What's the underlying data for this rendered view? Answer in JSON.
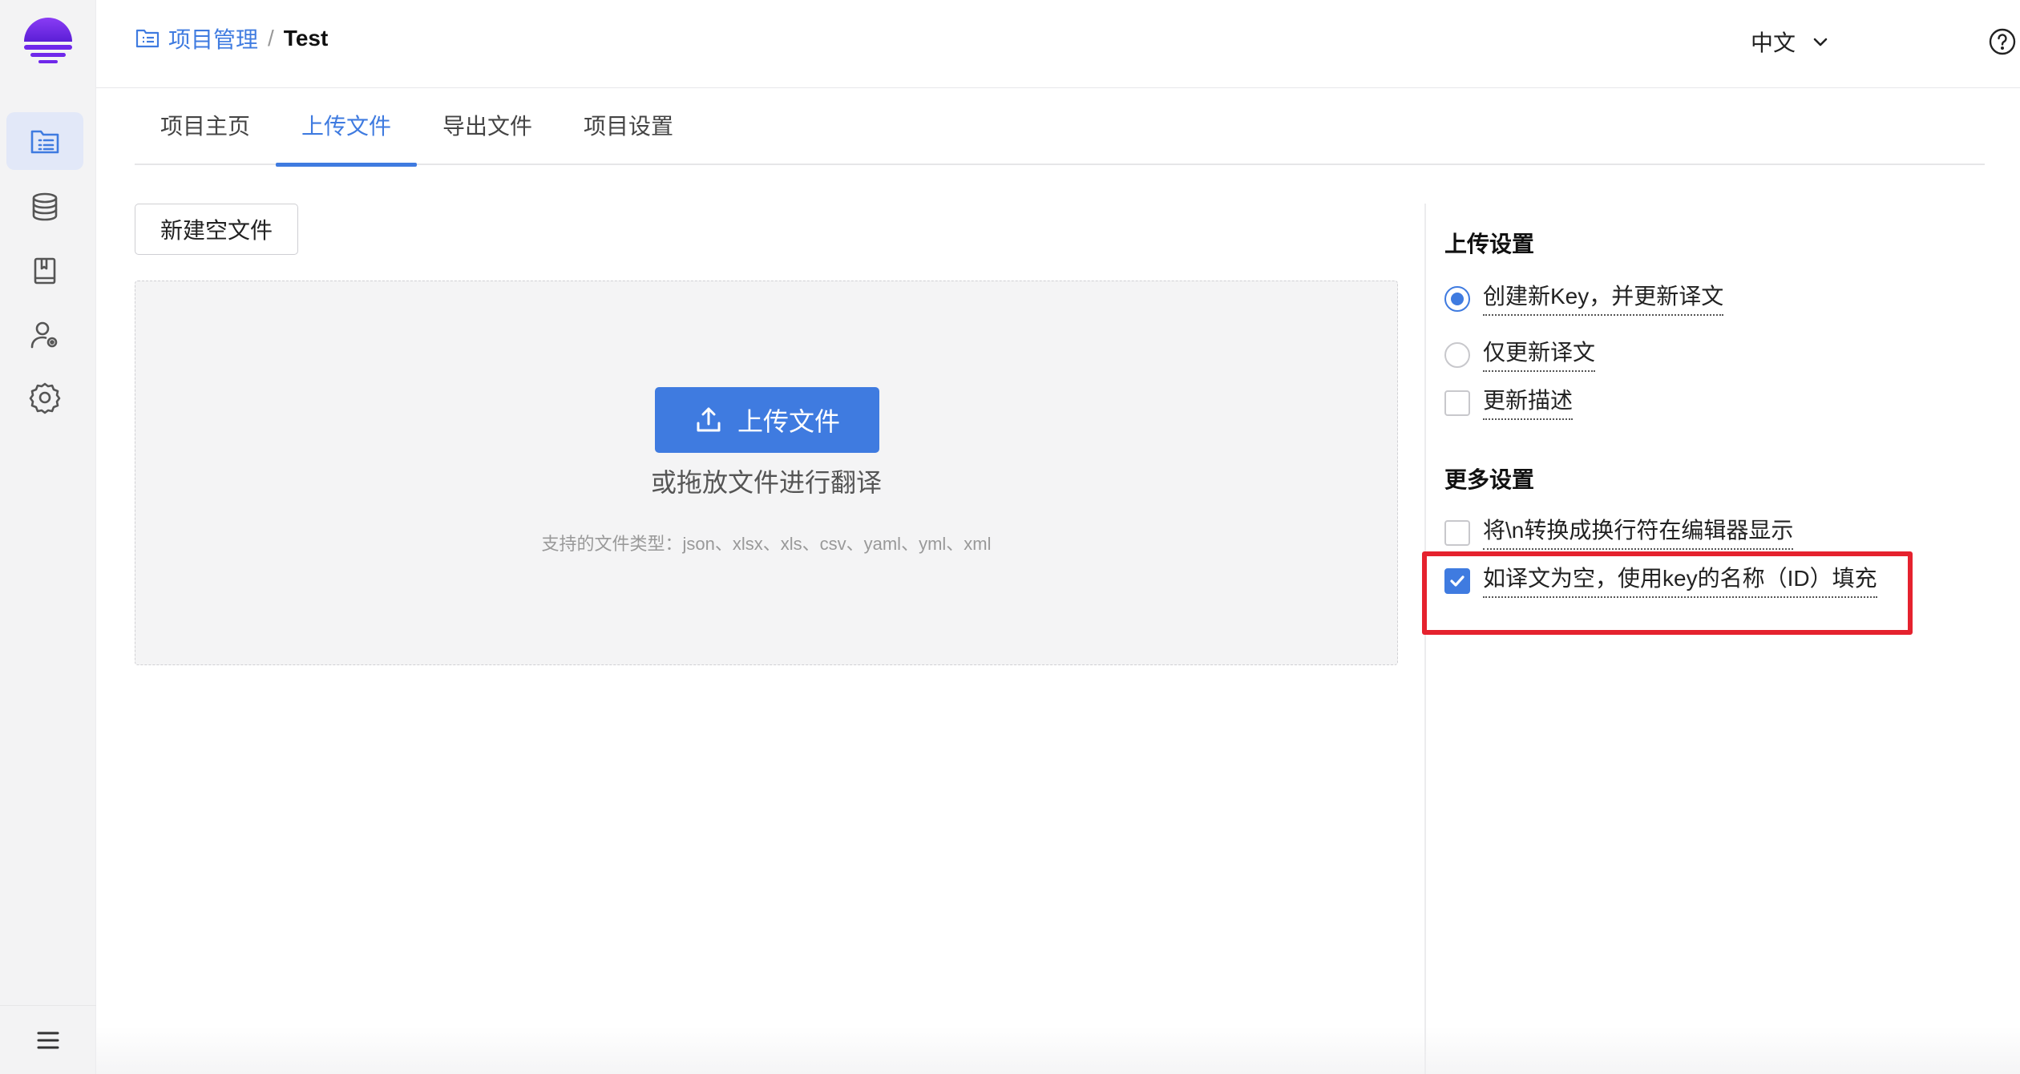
{
  "header": {
    "breadcrumb": {
      "section": "项目管理",
      "separator": "/",
      "current": "Test"
    },
    "language": "中文"
  },
  "tabs": [
    {
      "label": "项目主页",
      "active": false
    },
    {
      "label": "上传文件",
      "active": true
    },
    {
      "label": "导出文件",
      "active": false
    },
    {
      "label": "项目设置",
      "active": false
    }
  ],
  "main": {
    "new_file_label": "新建空文件",
    "upload_label": "上传文件",
    "drop_hint": "或拖放文件进行翻译",
    "file_types": "支持的文件类型：json、xlsx、xls、csv、yaml、yml、xml"
  },
  "settings": {
    "upload_title": "上传设置",
    "upload_options": [
      {
        "label": "创建新Key，并更新译文",
        "type": "radio",
        "checked": true
      },
      {
        "label": "仅更新译文",
        "type": "radio",
        "checked": false
      },
      {
        "label": "更新描述",
        "type": "checkbox",
        "checked": false
      }
    ],
    "more_title": "更多设置",
    "more_options": [
      {
        "label": "将\\n转换成换行符在编辑器显示",
        "type": "checkbox",
        "checked": false
      },
      {
        "label": "如译文为空，使用key的名称（ID）填充",
        "type": "checkbox",
        "checked": true
      }
    ]
  },
  "colors": {
    "accent": "#3f7be0",
    "highlight": "#e5222e",
    "logo": "#7b2ff2"
  },
  "icons": {
    "sidebar": [
      "project-list-icon",
      "database-icon",
      "book-icon",
      "user-settings-icon",
      "gear-icon"
    ],
    "footer": "hamburger-menu-icon"
  }
}
